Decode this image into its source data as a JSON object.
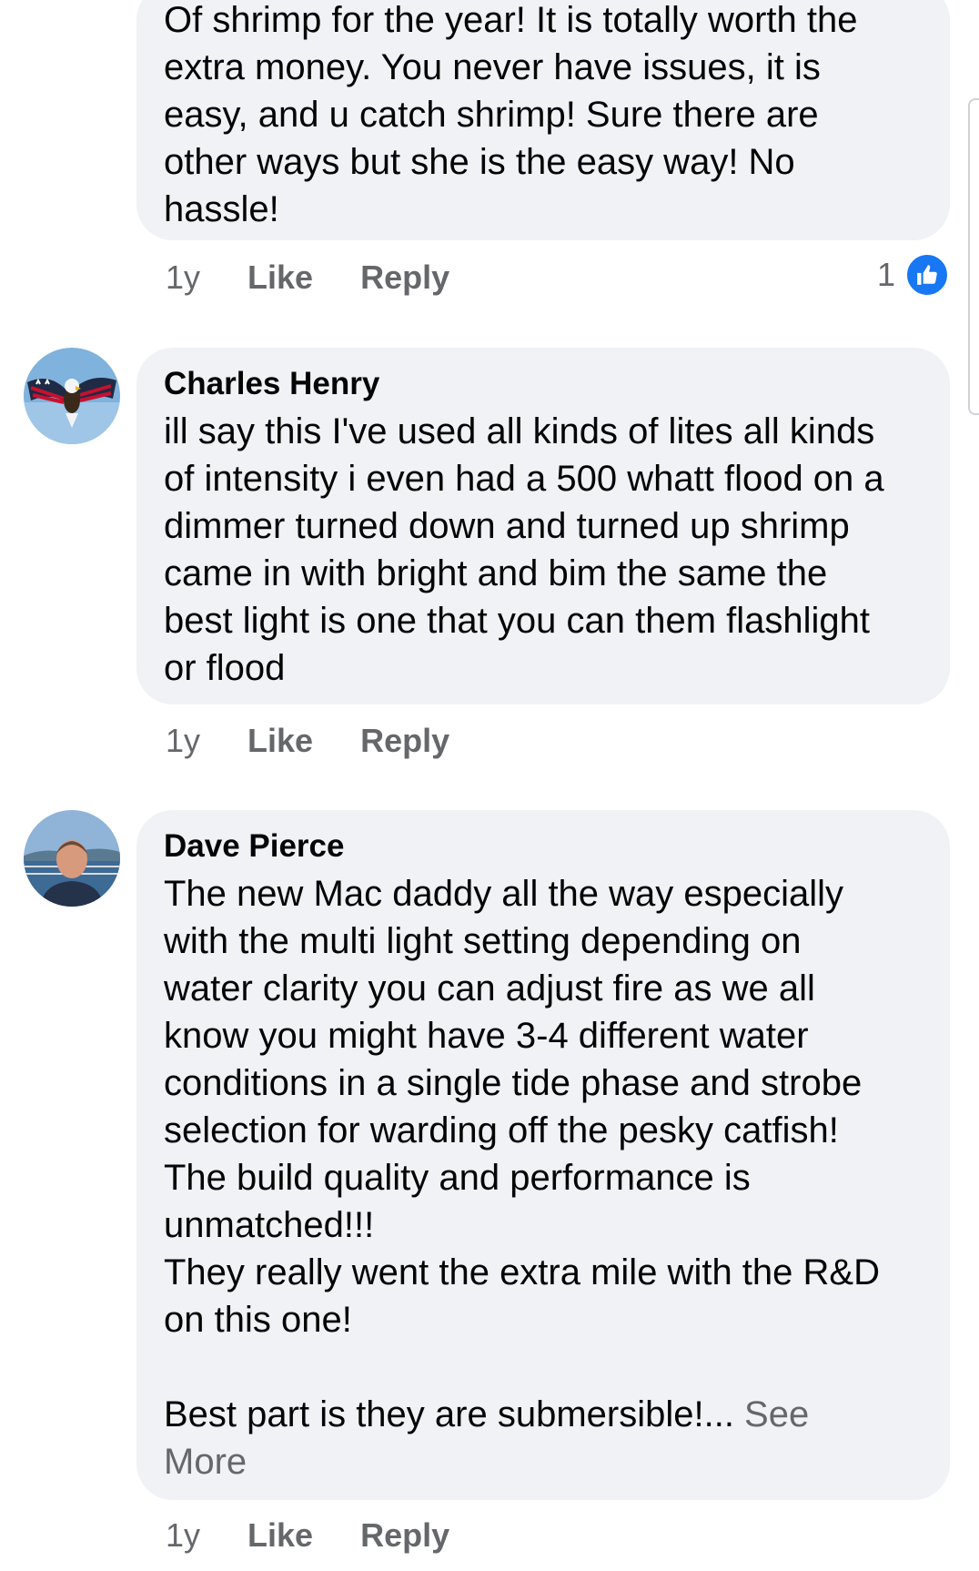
{
  "comments": [
    {
      "author": "",
      "text": "Of shrimp for the year!  It is totally worth the\nextra money.  You never have issues, it is\neasy, and u catch shrimp!  Sure there are\nother ways but she is the easy way!  No\nhassle!",
      "time": "1y",
      "like_label": "Like",
      "reply_label": "Reply",
      "reaction_count": "1"
    },
    {
      "author": "Charles Henry",
      "text": "ill say this I've used all kinds of lites all kinds\nof intensity i even had a 500 whatt flood on a\ndimmer turned down and turned up shrimp\ncame in with bright and bim the same the\nbest light is one that you can them flashlight\nor flood",
      "time": "1y",
      "like_label": "Like",
      "reply_label": "Reply"
    },
    {
      "author": "Dave Pierce",
      "text": "The new Mac daddy all the way especially\nwith the multi light setting depending on\nwater clarity you can adjust fire as we all\nknow you might have 3-4 different water\nconditions in a single tide phase and strobe\nselection for warding off the pesky catfish!\nThe build quality and performance is\nunmatched!!!\nThey really went the extra mile with the R&D\non this one!\n\nBest part is they are submersible!...",
      "see_more": " See\nMore",
      "time": "1y",
      "like_label": "Like",
      "reply_label": "Reply"
    }
  ],
  "colors": {
    "bubble": "#f0f2f5",
    "secondary_text": "#65676b",
    "like_blue": "#1877f2"
  },
  "icons": {
    "reaction": "like-thumbs-up-icon",
    "avatar_1": "eagle-flag-avatar",
    "avatar_2": "man-on-boat-avatar"
  }
}
